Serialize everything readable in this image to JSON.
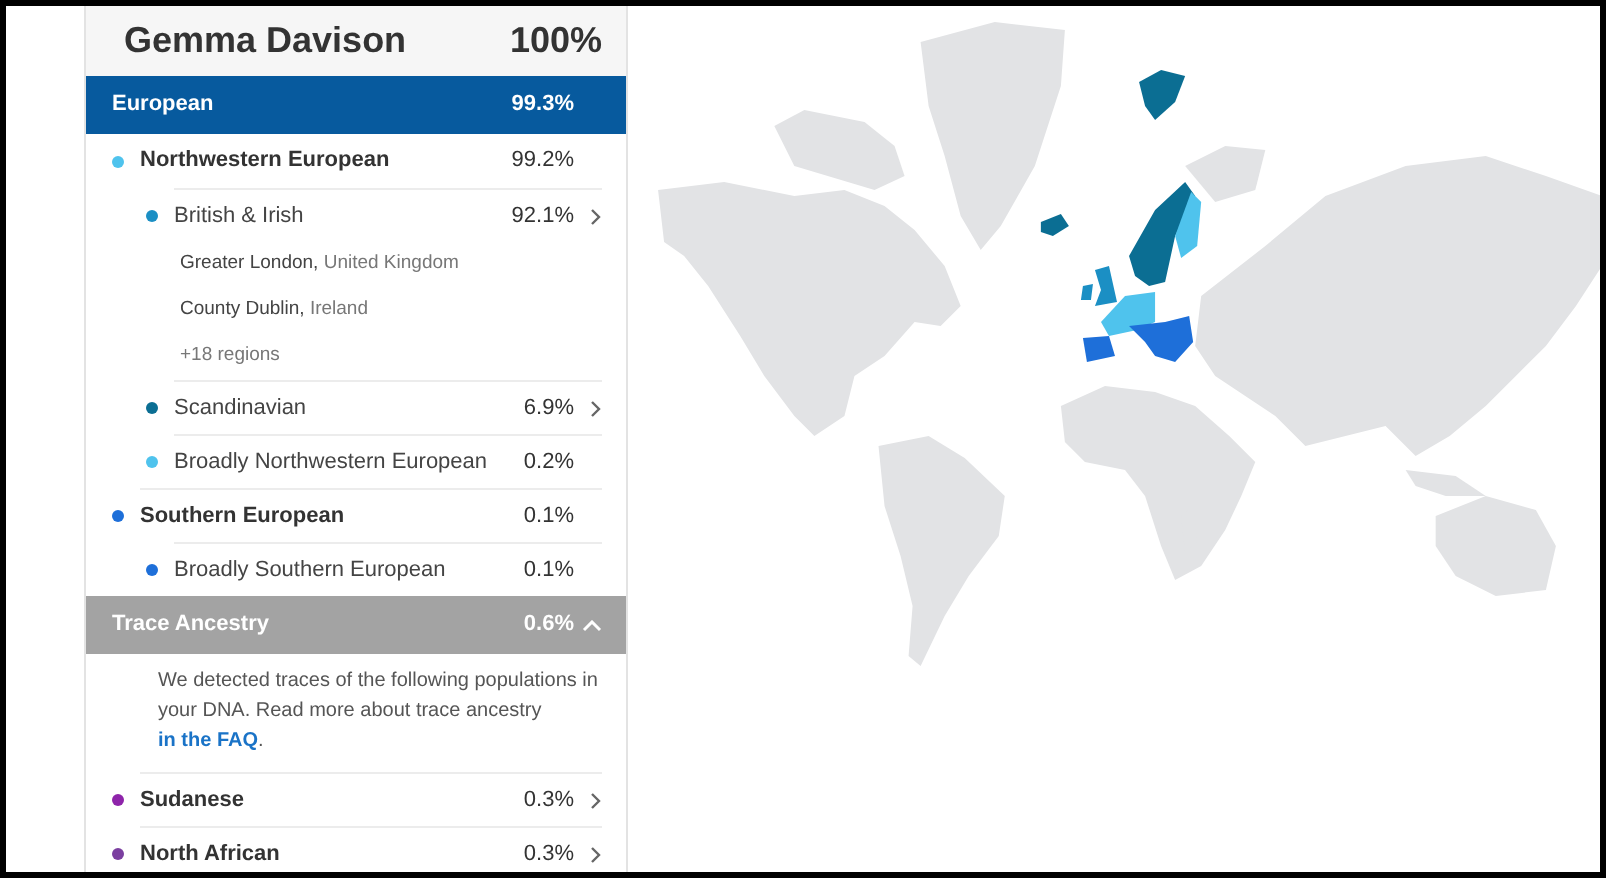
{
  "profile": {
    "name": "Gemma Davison",
    "total": "100%"
  },
  "groups": [
    {
      "label": "European",
      "percent": "99.3%",
      "color": "#075a9e",
      "populations": [
        {
          "name": "Northwestern European",
          "percent": "99.2%",
          "color": "#4fc3ed",
          "has_details": false,
          "children": [
            {
              "name": "British & Irish",
              "percent": "92.1%",
              "color": "#1b8fc4",
              "has_details": true,
              "regions": [
                {
                  "place": "Greater London,",
                  "country": "United Kingdom"
                },
                {
                  "place": "County Dublin,",
                  "country": "Ireland"
                }
              ],
              "more": "+18 regions"
            },
            {
              "name": "Scandinavian",
              "percent": "6.9%",
              "color": "#0b6e93",
              "has_details": true
            },
            {
              "name": "Broadly Northwestern European",
              "percent": "0.2%",
              "color": "#4fc3ed",
              "has_details": false
            }
          ]
        },
        {
          "name": "Southern European",
          "percent": "0.1%",
          "color": "#1e6fd9",
          "has_details": false,
          "children": [
            {
              "name": "Broadly Southern European",
              "percent": "0.1%",
              "color": "#1e6fd9",
              "has_details": false
            }
          ]
        }
      ]
    },
    {
      "label": "Trace Ancestry",
      "percent": "0.6%",
      "color": "#a3a3a3",
      "expanded": true,
      "note": "We detected traces of the following populations in your DNA. Read more about trace ancestry ",
      "link": "in the FAQ",
      "note_end": ".",
      "populations": [
        {
          "name": "Sudanese",
          "percent": "0.3%",
          "color": "#8e24aa",
          "has_details": true
        },
        {
          "name": "North African",
          "percent": "0.3%",
          "color": "#7b3fa0",
          "has_details": true
        }
      ]
    }
  ]
}
